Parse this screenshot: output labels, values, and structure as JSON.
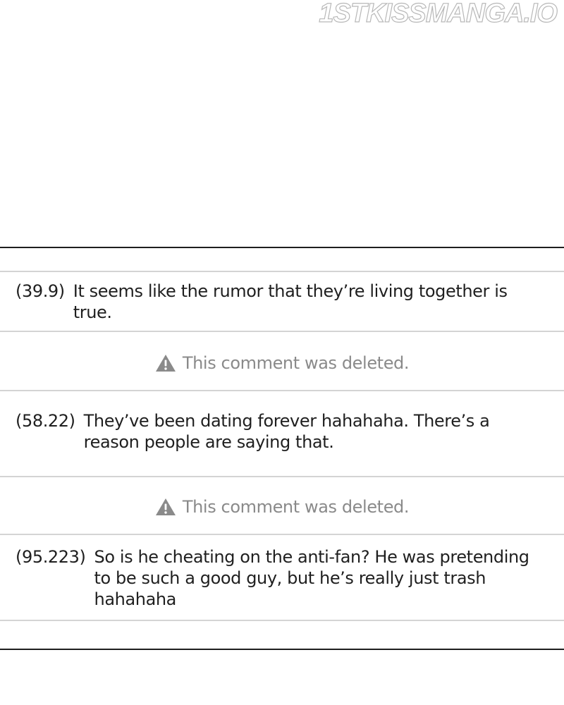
{
  "watermark": "1STKISSMANGA.IO",
  "comments": [
    {
      "timestamp": "(39.9)",
      "text": "It seems like the rumor that they’re living together is true."
    },
    {
      "deleted_text": "This comment was deleted.",
      "icon": "warning-triangle-icon"
    },
    {
      "timestamp": "(58.22)",
      "text": "They’ve been dating forever hahahaha. There’s a reason people are saying that."
    },
    {
      "deleted_text": "This comment was deleted.",
      "icon": "warning-triangle-icon"
    },
    {
      "timestamp": "(95.223)",
      "text": "So is he cheating on the anti-fan? He was pretending to be such a good guy, but he’s really just trash hahahaha"
    }
  ],
  "colors": {
    "rule_dark": "#1e1e1e",
    "rule_light": "#d4d4d4",
    "deleted_text": "#8a8a8a"
  }
}
